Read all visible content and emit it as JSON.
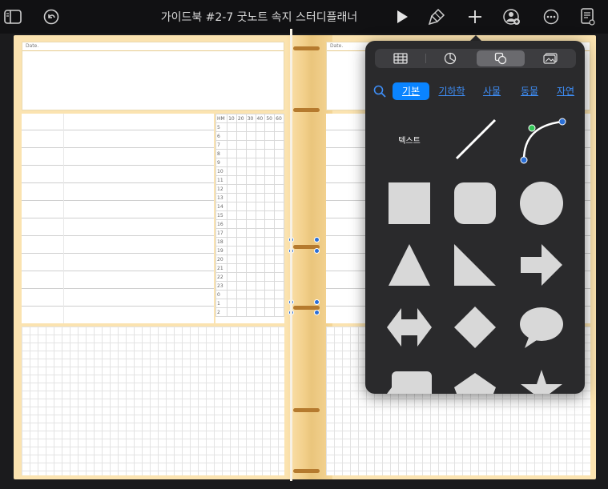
{
  "toolbar": {
    "title": "가이드북 #2-7 굿노트 속지 스터디플래너"
  },
  "notebook": {
    "date_label_left": "Date.",
    "date_label_right": "Date.",
    "hm_header": [
      "HM",
      "10",
      "20",
      "30",
      "40",
      "50",
      "60"
    ],
    "hours": [
      "5",
      "6",
      "7",
      "8",
      "9",
      "10",
      "11",
      "12",
      "13",
      "14",
      "15",
      "16",
      "17",
      "18",
      "19",
      "20",
      "21",
      "22",
      "23",
      "0",
      "1",
      "2"
    ]
  },
  "shape_picker": {
    "tabs": [
      {
        "name": "table",
        "icon": "table-icon"
      },
      {
        "name": "chart",
        "icon": "chart-icon"
      },
      {
        "name": "shapes",
        "icon": "shapes-icon",
        "active": true
      },
      {
        "name": "media",
        "icon": "media-icon"
      }
    ],
    "categories": [
      {
        "label": "기본",
        "active": true
      },
      {
        "label": "기하학",
        "active": false
      },
      {
        "label": "사물",
        "active": false
      },
      {
        "label": "동물",
        "active": false
      },
      {
        "label": "자연",
        "active": false
      }
    ],
    "text_shape_label": "텍스트",
    "shapes": [
      "text",
      "line",
      "curve",
      "square",
      "rounded-square",
      "circle",
      "triangle",
      "right-triangle",
      "arrow",
      "double-arrow",
      "diamond",
      "speech-bubble",
      "callout",
      "pentagon",
      "star"
    ]
  },
  "colors": {
    "accent": "#0a84ff",
    "shape_fill": "#d8d8d8",
    "popover_bg": "#2a2a2c",
    "binder": "#fbe3b0"
  }
}
